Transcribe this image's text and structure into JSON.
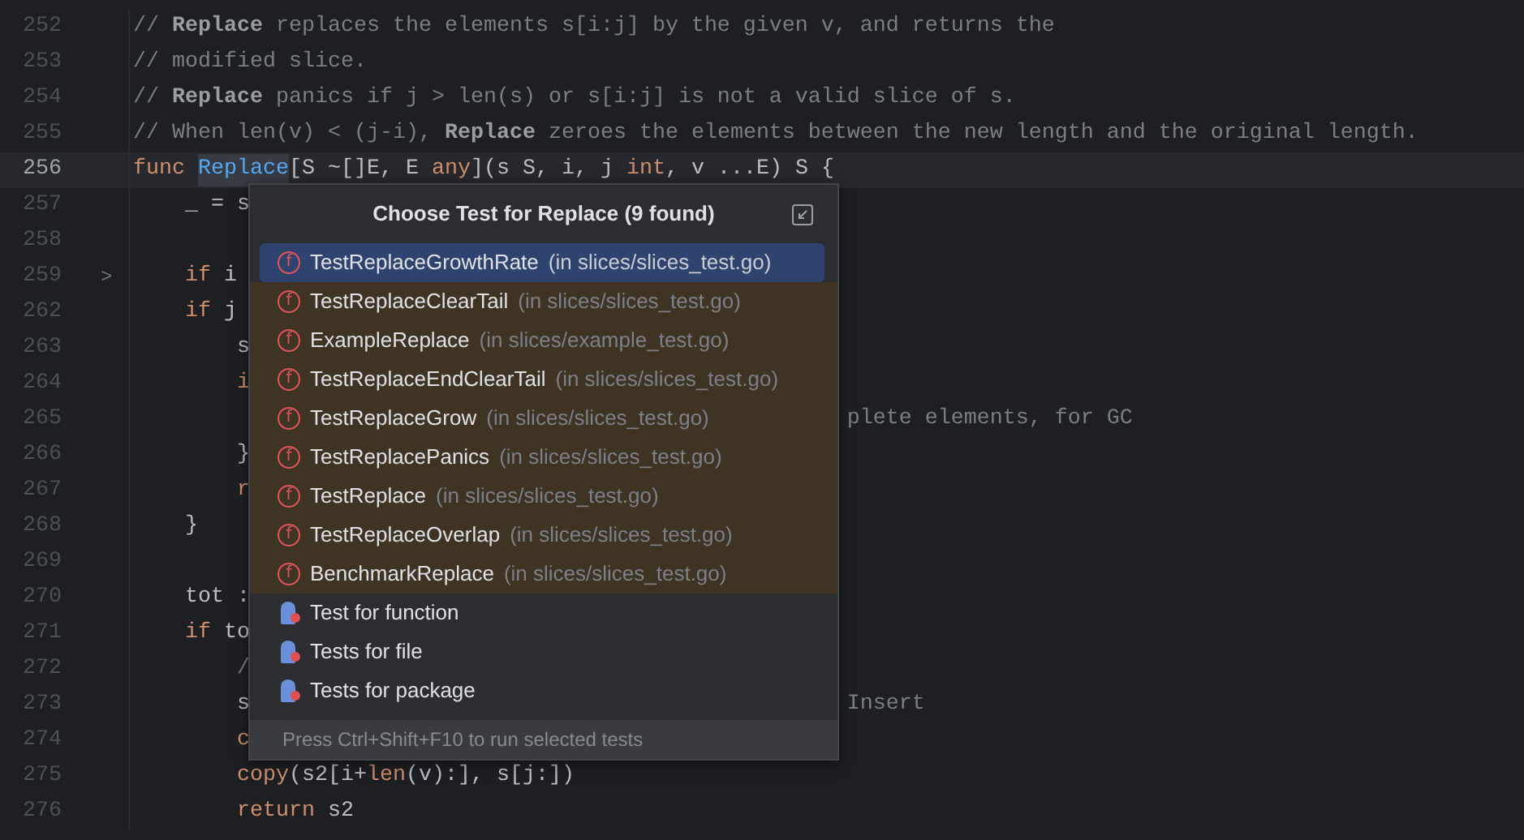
{
  "editor": {
    "lines": [
      {
        "number": "252",
        "current": false,
        "segments": [
          {
            "kind": "comment",
            "text": "// "
          },
          {
            "kind": "ref",
            "text": "Replace"
          },
          {
            "kind": "comment",
            "text": " replaces the elements s[i:j] by the given v, and returns the"
          }
        ]
      },
      {
        "number": "253",
        "current": false,
        "segments": [
          {
            "kind": "comment",
            "text": "// modified slice."
          }
        ]
      },
      {
        "number": "254",
        "current": false,
        "segments": [
          {
            "kind": "comment",
            "text": "// "
          },
          {
            "kind": "ref",
            "text": "Replace"
          },
          {
            "kind": "comment",
            "text": " panics if j > len(s) or s[i:j] is not a valid slice of s."
          }
        ]
      },
      {
        "number": "255",
        "current": false,
        "segments": [
          {
            "kind": "comment",
            "text": "// When len(v) < (j-i), "
          },
          {
            "kind": "ref",
            "text": "Replace"
          },
          {
            "kind": "comment",
            "text": " zeroes the elements between the new length and the original length."
          }
        ]
      },
      {
        "number": "256",
        "current": true,
        "segments": [
          {
            "kind": "keyword",
            "text": "func "
          },
          {
            "kind": "func",
            "text": "Replace"
          },
          {
            "kind": "plain",
            "text": "[S ~[]E, E "
          },
          {
            "kind": "keyword",
            "text": "any"
          },
          {
            "kind": "plain",
            "text": "](s S, i, j "
          },
          {
            "kind": "keyword",
            "text": "int"
          },
          {
            "kind": "plain",
            "text": ", v ...E) S {"
          }
        ]
      },
      {
        "number": "257",
        "current": false,
        "segments": [
          {
            "kind": "plain",
            "text": "    _ = s"
          }
        ]
      },
      {
        "number": "258",
        "current": false
      },
      {
        "number": "259",
        "current": false,
        "fold_mark": ">",
        "segments": [
          {
            "kind": "keyword",
            "text": "    if"
          },
          {
            "kind": "plain",
            "text": " i"
          }
        ]
      },
      {
        "number": "262",
        "current": false,
        "segments": [
          {
            "kind": "keyword",
            "text": "    if"
          },
          {
            "kind": "plain",
            "text": " j"
          }
        ]
      },
      {
        "number": "263",
        "current": false,
        "segments": [
          {
            "kind": "plain",
            "text": "        s"
          }
        ]
      },
      {
        "number": "264",
        "current": false,
        "segments": [
          {
            "kind": "keyword",
            "text": "        i"
          }
        ]
      },
      {
        "number": "265",
        "current": false,
        "tail": {
          "kind": "comment",
          "text": "plete elements, for GC"
        }
      },
      {
        "number": "266",
        "current": false,
        "segments": [
          {
            "kind": "plain",
            "text": "        }"
          }
        ]
      },
      {
        "number": "267",
        "current": false,
        "segments": [
          {
            "kind": "keyword",
            "text": "        r"
          }
        ]
      },
      {
        "number": "268",
        "current": false,
        "segments": [
          {
            "kind": "plain",
            "text": "    }"
          }
        ]
      },
      {
        "number": "269",
        "current": false
      },
      {
        "number": "270",
        "current": false,
        "segments": [
          {
            "kind": "plain",
            "text": "    tot :"
          }
        ]
      },
      {
        "number": "271",
        "current": false,
        "segments": [
          {
            "kind": "keyword",
            "text": "    if"
          },
          {
            "kind": "plain",
            "text": " to"
          }
        ]
      },
      {
        "number": "272",
        "current": false,
        "segments": [
          {
            "kind": "comment",
            "text": "        /"
          }
        ]
      },
      {
        "number": "273",
        "current": false,
        "segments": [
          {
            "kind": "plain",
            "text": "        s"
          }
        ],
        "tail": {
          "kind": "comment",
          "text": "Insert"
        }
      },
      {
        "number": "274",
        "current": false,
        "segments": [
          {
            "kind": "keyword",
            "text": "        c"
          }
        ]
      },
      {
        "number": "275",
        "current": false,
        "segments": [
          {
            "kind": "keyword",
            "text": "        copy"
          },
          {
            "kind": "plain",
            "text": "(s2[i+"
          },
          {
            "kind": "keyword",
            "text": "len"
          },
          {
            "kind": "plain",
            "text": "(v):], s[j:])"
          }
        ]
      },
      {
        "number": "276",
        "current": false,
        "segments": [
          {
            "kind": "keyword",
            "text": "        return"
          },
          {
            "kind": "plain",
            "text": " s2"
          }
        ]
      }
    ]
  },
  "popup": {
    "title": "Choose Test for Replace (9 found)",
    "items": [
      {
        "kind": "test",
        "icon_letter": "f",
        "name": "TestReplaceGrowthRate",
        "location": "(in slices/slices_test.go)",
        "selected": true
      },
      {
        "kind": "test",
        "icon_letter": "f",
        "name": "TestReplaceClearTail",
        "location": "(in slices/slices_test.go)",
        "selected": false
      },
      {
        "kind": "test",
        "icon_letter": "f",
        "name": "ExampleReplace",
        "location": "(in slices/example_test.go)",
        "selected": false
      },
      {
        "kind": "test",
        "icon_letter": "f",
        "name": "TestReplaceEndClearTail",
        "location": "(in slices/slices_test.go)",
        "selected": false
      },
      {
        "kind": "test",
        "icon_letter": "f",
        "name": "TestReplaceGrow",
        "location": "(in slices/slices_test.go)",
        "selected": false
      },
      {
        "kind": "test",
        "icon_letter": "f",
        "name": "TestReplacePanics",
        "location": "(in slices/slices_test.go)",
        "selected": false
      },
      {
        "kind": "test",
        "icon_letter": "f",
        "name": "TestReplace",
        "location": "(in slices/slices_test.go)",
        "selected": false
      },
      {
        "kind": "test",
        "icon_letter": "f",
        "name": "TestReplaceOverlap",
        "location": "(in slices/slices_test.go)",
        "selected": false
      },
      {
        "kind": "test",
        "icon_letter": "f",
        "name": "BenchmarkReplace",
        "location": "(in slices/slices_test.go)",
        "selected": false
      },
      {
        "kind": "scope",
        "name": "Test for function",
        "selected": false
      },
      {
        "kind": "scope",
        "name": "Tests for file",
        "selected": false
      },
      {
        "kind": "scope",
        "name": "Tests for package",
        "selected": false
      }
    ],
    "hint": "Press Ctrl+Shift+F10 to run selected tests"
  }
}
